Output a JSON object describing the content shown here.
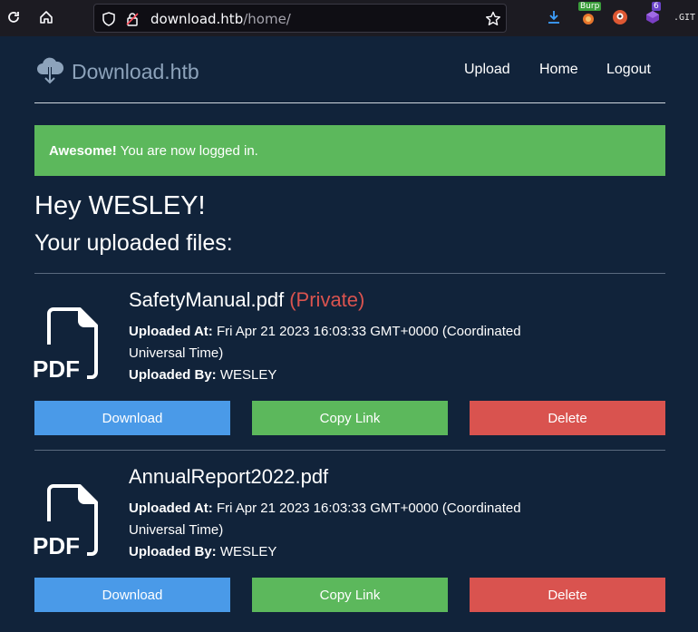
{
  "browser": {
    "url_host": "download.htb",
    "url_path": "/home/",
    "ext_burp_label": "Burp",
    "ext_badge_count": "6",
    "ext_git_label": ".GIT"
  },
  "site": {
    "brand": "Download.htb",
    "nav": {
      "upload": "Upload",
      "home": "Home",
      "logout": "Logout"
    },
    "alert": {
      "strong": "Awesome!",
      "text": "You are now logged in."
    },
    "greeting": "Hey WESLEY!",
    "subheading": "Your uploaded files:",
    "files": [
      {
        "name": "SafetyManual.pdf",
        "visibility": "(Private)",
        "uploaded_at_label": "Uploaded At:",
        "uploaded_at": "Fri Apr 21 2023 16:03:33 GMT+0000 (Coordinated Universal Time)",
        "uploaded_by_label": "Uploaded By:",
        "uploaded_by": "WESLEY",
        "icon_label": "PDF",
        "download_label": "Download",
        "copy_label": "Copy Link",
        "delete_label": "Delete"
      },
      {
        "name": "AnnualReport2022.pdf",
        "uploaded_at_label": "Uploaded At:",
        "uploaded_at": "Fri Apr 21 2023 16:03:33 GMT+0000 (Coordinated Universal Time)",
        "uploaded_by_label": "Uploaded By:",
        "uploaded_by": "WESLEY",
        "icon_label": "PDF",
        "download_label": "Download",
        "copy_label": "Copy Link",
        "delete_label": "Delete"
      }
    ]
  },
  "colors": {
    "background": "#11233a",
    "alert_success": "#5cb85c",
    "download_button": "#4a9ae8",
    "copy_button": "#5cb85c",
    "delete_button": "#d9534f",
    "private_text": "#d9534f"
  }
}
